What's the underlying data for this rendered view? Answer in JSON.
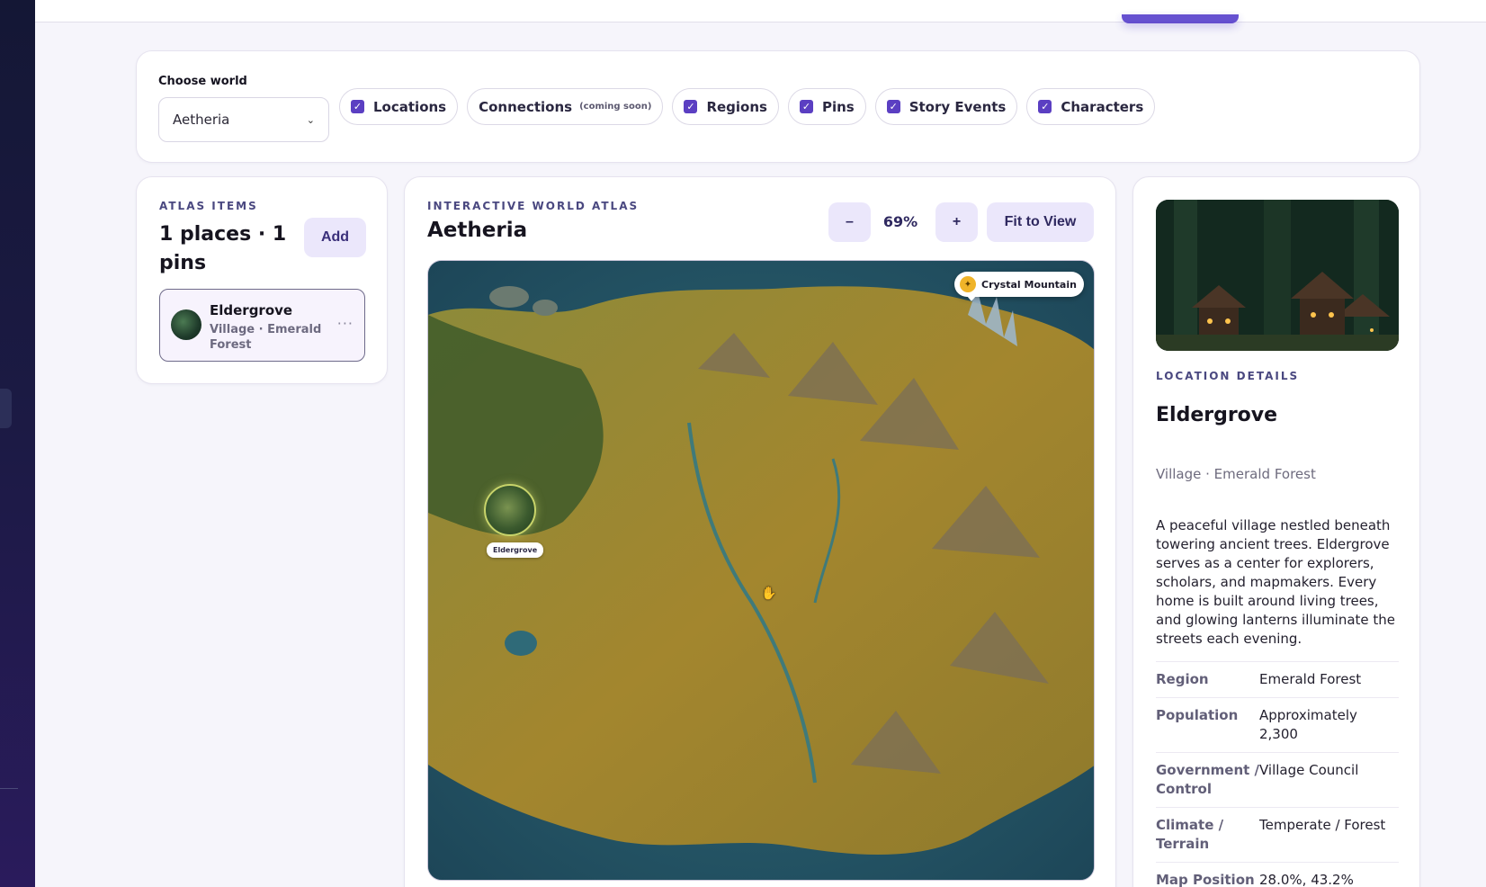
{
  "filters": {
    "choose_label": "Choose world",
    "world_value": "Aetheria",
    "chips": [
      {
        "label": "Locations",
        "checked": true
      },
      {
        "label": "Connections",
        "note": "(coming soon)",
        "checked": false
      },
      {
        "label": "Regions",
        "checked": true
      },
      {
        "label": "Pins",
        "checked": true
      },
      {
        "label": "Story Events",
        "checked": true
      },
      {
        "label": "Characters",
        "checked": true
      }
    ]
  },
  "atlas_items": {
    "eyebrow": "ATLAS ITEMS",
    "title": "1 places · 1 pins",
    "add_label": "Add",
    "items": [
      {
        "name": "Eldergrove",
        "subtitle": "Village · Emerald Forest",
        "more": "···"
      }
    ]
  },
  "map": {
    "eyebrow": "INTERACTIVE WORLD ATLAS",
    "title": "Aetheria",
    "zoom_out_label": "–",
    "zoom_level": "69%",
    "zoom_in_label": "+",
    "fit_label": "Fit to View",
    "pins": [
      {
        "label": "Crystal Mountain",
        "icon": "star-icon",
        "color": "#f0b429"
      }
    ],
    "locations": [
      {
        "label": "Eldergrove"
      }
    ]
  },
  "detail": {
    "eyebrow": "LOCATION DETAILS",
    "title": "Eldergrove",
    "subtitle": "Village · Emerald Forest",
    "description": "A peaceful village nestled beneath towering ancient trees. Eldergrove serves as a center for explorers, scholars, and mapmakers. Every home is built around living trees, and glowing lanterns illuminate the streets each evening.",
    "properties": [
      {
        "key": "Region",
        "value": "Emerald Forest"
      },
      {
        "key": "Population",
        "value": "Approximately 2,300"
      },
      {
        "key": "Government / Control",
        "value": "Village Council"
      },
      {
        "key": "Climate / Terrain",
        "value": "Temperate / Forest"
      },
      {
        "key": "Map Position",
        "value": "28.0%, 43.2%"
      }
    ]
  },
  "colors": {
    "accent": "#5b3fc2",
    "accent_soft": "#ebe7fb",
    "pin_gold": "#f0b429"
  }
}
